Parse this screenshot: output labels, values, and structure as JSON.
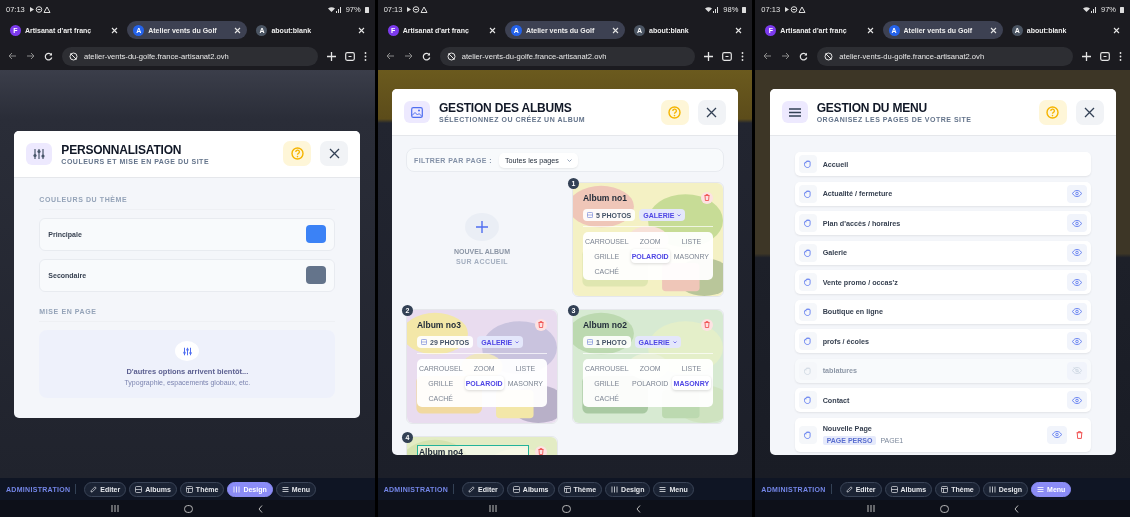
{
  "screens": [
    {
      "status_bar": {
        "time": "07:13",
        "battery": "97%"
      },
      "tabs": [
        {
          "icon_letter": "F",
          "label": "Artisanat d'art franç",
          "selected": false
        },
        {
          "icon_letter": "A",
          "label": "Atelier vents du Golf",
          "selected": true
        },
        {
          "icon_letter": "A",
          "label": "about:blank",
          "selected": false
        }
      ],
      "url": "atelier-vents-du-golfe.france-artisanat2.ovh",
      "modal": {
        "kind": "theme",
        "title": "PERSONNALISATION",
        "subtitle": "COULEURS ET MISE EN PAGE DU SITE",
        "sections": [
          {
            "heading": "COULEURS DU THÈME",
            "colors": [
              {
                "label": "Principale",
                "color": "#3b82f6"
              },
              {
                "label": "Secondaire",
                "color": "#64748b"
              }
            ]
          },
          {
            "heading": "MISE EN PAGE",
            "notice": {
              "title": "D'autres options arrivent bientôt...",
              "text": "Typographie, espacements globaux, etc."
            }
          }
        ]
      },
      "admin_bar": {
        "label": "ADMINISTRATION",
        "buttons": [
          {
            "label": "Editer",
            "selected": false
          },
          {
            "label": "Albums",
            "selected": false
          },
          {
            "label": "Thème",
            "selected": false
          },
          {
            "label": "Design",
            "selected": true
          },
          {
            "label": "Menu",
            "selected": false
          }
        ]
      }
    },
    {
      "status_bar": {
        "time": "07:13",
        "battery": "98%"
      },
      "tabs": [
        {
          "icon_letter": "F",
          "label": "Artisanat d'art franç",
          "selected": false
        },
        {
          "icon_letter": "A",
          "label": "Atelier vents du Golf",
          "selected": true
        },
        {
          "icon_letter": "A",
          "label": "about:blank",
          "selected": false
        }
      ],
      "url": "atelier-vents-du-golfe.france-artisanat2.ovh",
      "modal": {
        "kind": "albums",
        "title": "GESTION DES ALBUMS",
        "subtitle": "SÉLECTIONNEZ OU CRÉEZ UN ALBUM",
        "filter_label": "FILTRER PAR PAGE :",
        "filter_value": "Toutes les pages",
        "new_album": {
          "label": "NOUVEL ALBUM",
          "sub": "SUR ACCUEIL"
        },
        "albums": [
          {
            "number": "1",
            "name": "Album no1",
            "editing": false,
            "count": "5 PHOTOS",
            "mode": "GALERIE",
            "options": [
              {
                "label": "CARROUSEL",
                "selected": false
              },
              {
                "label": "ZOOM",
                "selected": false
              },
              {
                "label": "LISTE",
                "selected": false
              },
              {
                "label": "GRILLE",
                "selected": false
              },
              {
                "label": "POLAROID",
                "selected": true
              },
              {
                "label": "MASONRY",
                "selected": false
              },
              {
                "label": "CACHÉ",
                "selected": false
              }
            ]
          },
          {
            "number": "2",
            "name": "Album no3",
            "editing": false,
            "count": "29 PHOTOS",
            "mode": "GALERIE",
            "options": [
              {
                "label": "CARROUSEL",
                "selected": false
              },
              {
                "label": "ZOOM",
                "selected": false
              },
              {
                "label": "LISTE",
                "selected": false
              },
              {
                "label": "GRILLE",
                "selected": false
              },
              {
                "label": "POLAROID",
                "selected": true
              },
              {
                "label": "MASONRY",
                "selected": false
              },
              {
                "label": "CACHÉ",
                "selected": false
              }
            ]
          },
          {
            "number": "3",
            "name": "Album no2",
            "editing": false,
            "count": "1 PHOTO",
            "mode": "GALERIE",
            "options": [
              {
                "label": "CARROUSEL",
                "selected": false
              },
              {
                "label": "ZOOM",
                "selected": false
              },
              {
                "label": "LISTE",
                "selected": false
              },
              {
                "label": "GRILLE",
                "selected": false
              },
              {
                "label": "POLAROID",
                "selected": false
              },
              {
                "label": "MASONRY",
                "selected": true
              },
              {
                "label": "CACHÉ",
                "selected": false
              }
            ]
          },
          {
            "number": "4",
            "name": "Album no4",
            "editing": true
          }
        ]
      },
      "admin_bar": {
        "label": "ADMINISTRATION",
        "buttons": [
          {
            "label": "Editer",
            "selected": false
          },
          {
            "label": "Albums",
            "selected": false
          },
          {
            "label": "Thème",
            "selected": false
          },
          {
            "label": "Design",
            "selected": false
          },
          {
            "label": "Menu",
            "selected": false
          }
        ]
      }
    },
    {
      "status_bar": {
        "time": "07:13",
        "battery": "97%"
      },
      "tabs": [
        {
          "icon_letter": "F",
          "label": "Artisanat d'art franç",
          "selected": false
        },
        {
          "icon_letter": "A",
          "label": "Atelier vents du Golf",
          "selected": true
        },
        {
          "icon_letter": "A",
          "label": "about:blank",
          "selected": false
        }
      ],
      "url": "atelier-vents-du-golfe.france-artisanat2.ovh",
      "modal": {
        "kind": "menu",
        "title": "GESTION DU MENU",
        "subtitle": "ORGANISEZ LES PAGES DE VOTRE SITE",
        "items": [
          {
            "label": "Accueil",
            "has_toggle": false,
            "visible": true
          },
          {
            "label": "Actualité / fermeture",
            "has_toggle": true,
            "visible": true
          },
          {
            "label": "Plan d'accès / horaires",
            "has_toggle": true,
            "visible": true
          },
          {
            "label": "Galerie",
            "has_toggle": true,
            "visible": true
          },
          {
            "label": "Vente promo / occas'z",
            "has_toggle": true,
            "visible": true
          },
          {
            "label": "Boutique en ligne",
            "has_toggle": true,
            "visible": true
          },
          {
            "label": "profs / écoles",
            "has_toggle": true,
            "visible": true
          },
          {
            "label": "tablatures",
            "has_toggle": true,
            "visible": false
          },
          {
            "label": "Contact",
            "has_toggle": true,
            "visible": true
          },
          {
            "label": "Nouvelle Page",
            "has_toggle": true,
            "visible": true,
            "tag": "PAGE PERSO",
            "slug": "PAGE1",
            "deletable": true
          }
        ]
      },
      "admin_bar": {
        "label": "ADMINISTRATION",
        "buttons": [
          {
            "label": "Editer",
            "selected": false
          },
          {
            "label": "Albums",
            "selected": false
          },
          {
            "label": "Thème",
            "selected": false
          },
          {
            "label": "Design",
            "selected": false
          },
          {
            "label": "Menu",
            "selected": true
          }
        ]
      }
    }
  ]
}
